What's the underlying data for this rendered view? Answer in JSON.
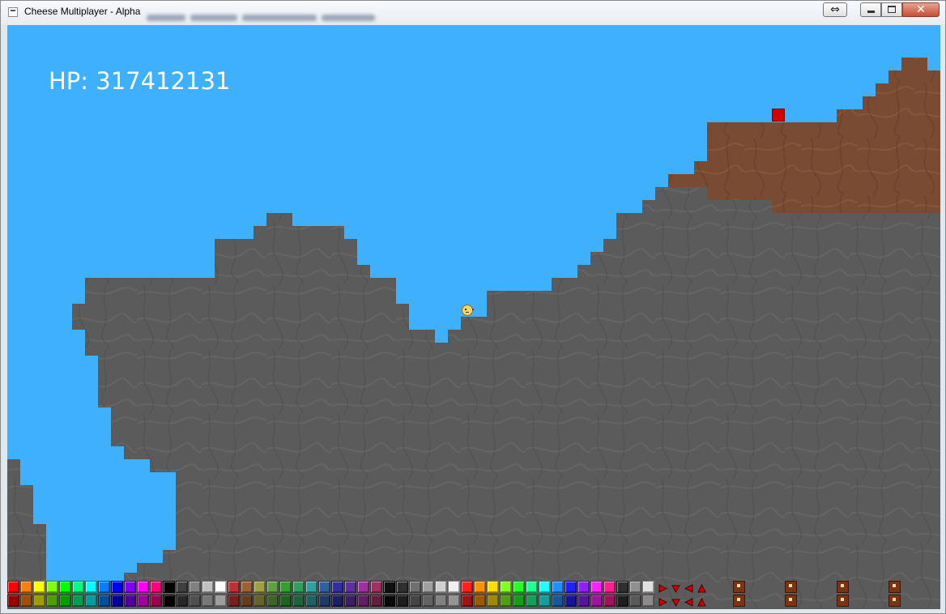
{
  "window": {
    "title": "Cheese Multiplayer - Alpha",
    "buttons": [
      "swap-button",
      "minimize-button",
      "maximize-button",
      "close-button"
    ]
  },
  "game": {
    "hp_label": "HP: 317412131",
    "background": "#3eb0fd",
    "terrain_colors": {
      "rock": "#5a5a5a",
      "dirt": "#7a4b32"
    },
    "player_icon": "smiley-player-icon",
    "block_color": "#d20000"
  },
  "palette": {
    "colors": [
      "#ff0000",
      "#ff8000",
      "#ffff00",
      "#80ff00",
      "#00ff00",
      "#00ff80",
      "#00ffff",
      "#0080ff",
      "#0000ff",
      "#8000ff",
      "#ff00ff",
      "#ff0080",
      "#000000",
      "#404040",
      "#808080",
      "#c0c0c0",
      "#ffffff",
      "#c03030",
      "#a06030",
      "#a0a040",
      "#60a040",
      "#30a030",
      "#30a060",
      "#30a0a0",
      "#3060a0",
      "#3030a0",
      "#6030a0",
      "#a030a0",
      "#a03060",
      "#101010",
      "#303030",
      "#707070",
      "#a0a0a0",
      "#d0d0d0",
      "#f0f0f0",
      "#ff2020",
      "#ff9000",
      "#ffdd00",
      "#80ff20",
      "#20ff20",
      "#20ff90",
      "#20ffff",
      "#2090ff",
      "#2020ff",
      "#9020ff",
      "#ff20ff",
      "#ff2090",
      "#303030",
      "#909090",
      "#e0e0e0"
    ],
    "tool_icons": [
      "arrow-right-icon",
      "arrow-down-icon",
      "arrow-left-icon",
      "arrow-up-icon"
    ],
    "door_icons": [
      "door-icon",
      "door-icon",
      "door-icon",
      "door-icon"
    ]
  }
}
